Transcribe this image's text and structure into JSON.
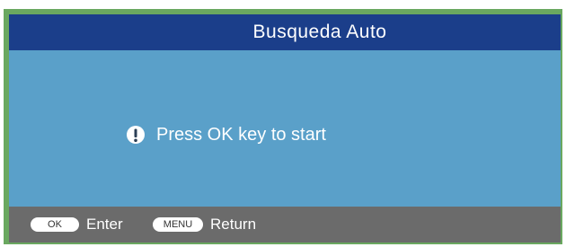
{
  "window": {
    "title": "Busqueda Auto"
  },
  "message": {
    "icon": "info-icon",
    "text": "Press OK key to start"
  },
  "footer": {
    "hints": [
      {
        "key": "OK",
        "label": "Enter"
      },
      {
        "key": "MENU",
        "label": "Return"
      }
    ]
  },
  "colors": {
    "title_bar": "#1b3e8a",
    "main_panel": "#5aa0c9",
    "footer": "#6b6b6b",
    "frame": "#6aa860"
  }
}
